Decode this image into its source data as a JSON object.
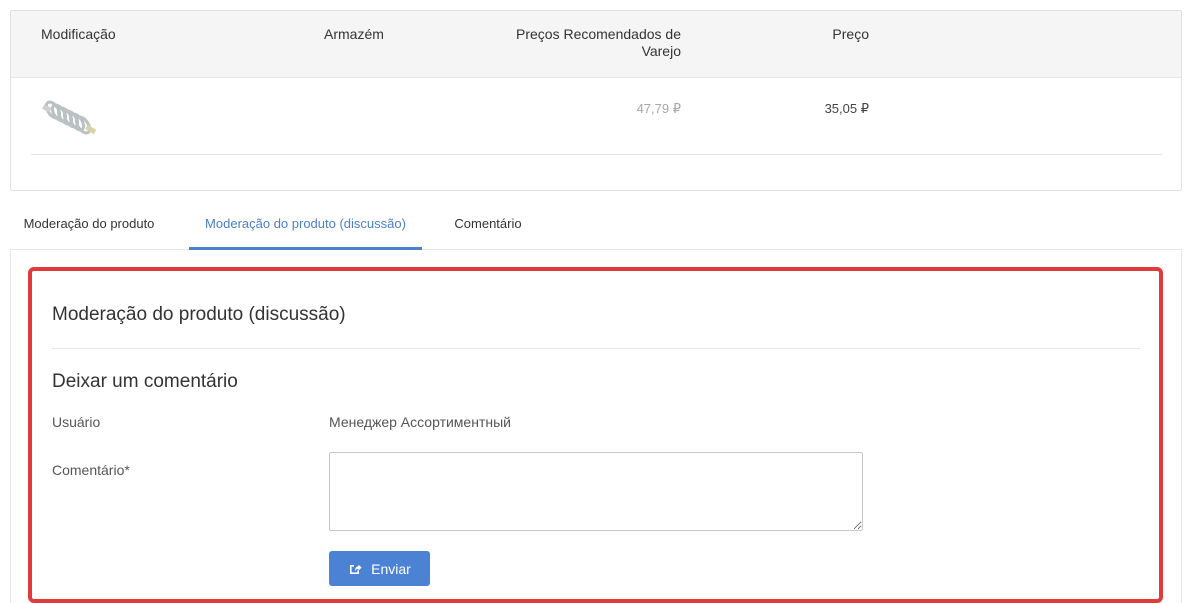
{
  "table": {
    "headers": {
      "modification": "Modificação",
      "warehouse": "Armazém",
      "recommended_retail_price": "Preços Recomendados de Varejo",
      "price": "Preço"
    },
    "rows": [
      {
        "image": "coiled-cable-image",
        "warehouse": "",
        "recommended_retail_price": "47,79 ₽",
        "price": "35,05 ₽"
      }
    ]
  },
  "tabs": [
    {
      "label": "Moderação do produto",
      "active": false
    },
    {
      "label": "Moderação do produto (discussão)",
      "active": true
    },
    {
      "label": "Comentário",
      "active": false
    }
  ],
  "panel": {
    "title": "Moderação do produto (discussão)",
    "section_title": "Deixar um comentário",
    "user_label": "Usuário",
    "user_value": "Менеджер Ассортиментный",
    "comment_label": "Comentário*",
    "comment_value": "",
    "submit_label": "Enviar",
    "submit_icon": "share-icon"
  },
  "colors": {
    "accent": "#4a7fcc",
    "button": "#4b82d4",
    "highlight": "#e03a3a"
  }
}
